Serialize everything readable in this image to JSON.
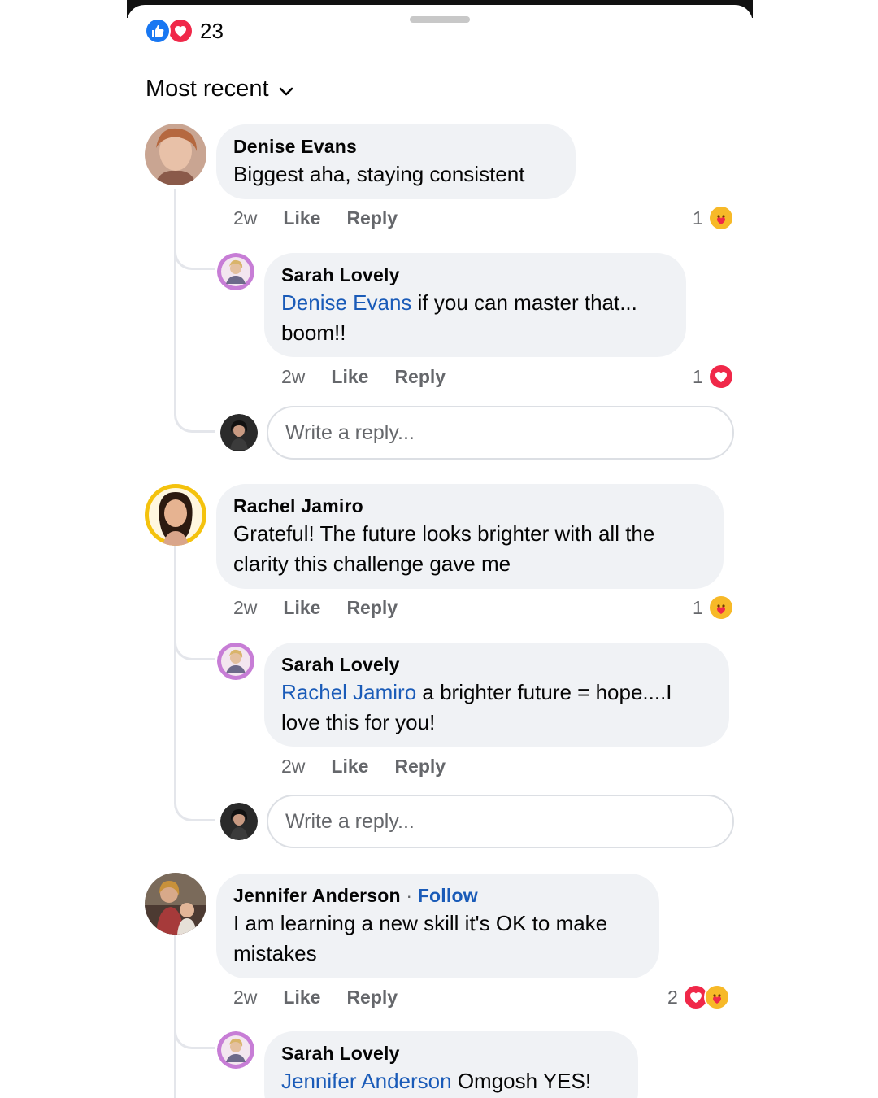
{
  "header": {
    "reaction_count": "23",
    "reaction_icons": [
      "thumbs-up-icon",
      "heart-icon"
    ],
    "sort_label": "Most recent"
  },
  "colors": {
    "mention": "#1a5bb8",
    "bubble": "#f0f2f5",
    "like_blue": "#1877f2",
    "love_red": "#f02849",
    "care_yellow": "#f7b928",
    "meta_gray": "#65676b"
  },
  "comments": [
    {
      "author": "Denise Evans",
      "text": "Biggest aha, staying consistent",
      "time": "2w",
      "like_label": "Like",
      "reply_label": "Reply",
      "reaction_count": "1",
      "reactions": [
        "care-icon"
      ],
      "reply": {
        "author": "Sarah  Lovely",
        "mention": "Denise Evans",
        "text": " if you can master that... boom!!",
        "time": "2w",
        "like_label": "Like",
        "reply_label": "Reply",
        "reaction_count": "1",
        "reactions": [
          "heart-icon"
        ]
      },
      "reply_placeholder": "Write a reply..."
    },
    {
      "author": "Rachel Jamiro",
      "text": "Grateful! The future looks brighter with all the clarity this challenge gave me",
      "time": "2w",
      "like_label": "Like",
      "reply_label": "Reply",
      "reaction_count": "1",
      "reactions": [
        "care-icon"
      ],
      "reply": {
        "author": "Sarah  Lovely",
        "mention": "Rachel Jamiro",
        "text": " a brighter future = hope....I love this for you!",
        "time": "2w",
        "like_label": "Like",
        "reply_label": "Reply"
      },
      "reply_placeholder": "Write a reply..."
    },
    {
      "author": "Jennifer Anderson",
      "separator": " · ",
      "follow_label": "Follow",
      "text": "I am learning a new skill it's OK to make mistakes",
      "time": "2w",
      "like_label": "Like",
      "reply_label": "Reply",
      "reaction_count": "2",
      "reactions": [
        "heart-icon",
        "care-icon"
      ],
      "reply": {
        "author": "Sarah  Lovely",
        "mention": "Jennifer Anderson",
        "text": " Omgosh YES!"
      }
    }
  ]
}
